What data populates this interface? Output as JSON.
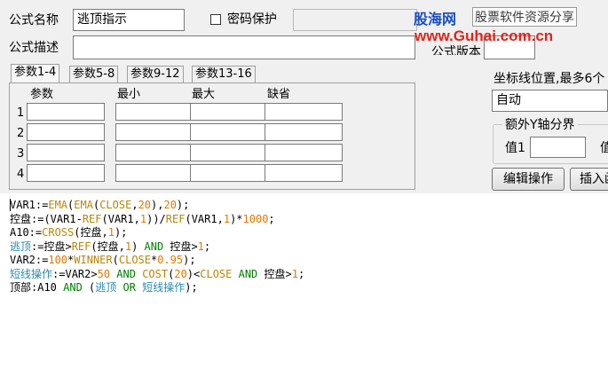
{
  "form": {
    "name_label": "公式名称",
    "name_value": "逃顶指示",
    "password_label": "密码保护",
    "desc_label": "公式描述",
    "version_label_partial": "公式版本"
  },
  "tabs": [
    "参数1-4",
    "参数5-8",
    "参数9-12",
    "参数13-16"
  ],
  "params": {
    "headers": [
      "参数",
      "最小",
      "最大",
      "缺省"
    ],
    "rows": [
      "1",
      "2",
      "3",
      "4"
    ]
  },
  "right_panel": {
    "axis_label": "坐标线位置,最多6个",
    "axis_value": "自动",
    "extra_group": "额外Y轴分界",
    "value1_label": "值1",
    "value2_label": "值",
    "edit_button": "编辑操作",
    "insert_button": "插入函"
  },
  "watermark": {
    "site": "股海网",
    "tagline": "股票软件资源分享",
    "url": "www.Guhai.com.cn"
  },
  "code_lines": [
    [
      {
        "t": "VAR1:=",
        "c": "k"
      },
      {
        "t": "EMA",
        "c": "f"
      },
      {
        "t": "(",
        "c": "k"
      },
      {
        "t": "EMA",
        "c": "f"
      },
      {
        "t": "(",
        "c": "k"
      },
      {
        "t": "CLOSE",
        "c": "f"
      },
      {
        "t": ",",
        "c": "k"
      },
      {
        "t": "20",
        "c": "n"
      },
      {
        "t": "),",
        "c": "k"
      },
      {
        "t": "20",
        "c": "n"
      },
      {
        "t": ");",
        "c": "k"
      }
    ],
    [
      {
        "t": "控盘:=(VAR1-",
        "c": "k"
      },
      {
        "t": "REF",
        "c": "f"
      },
      {
        "t": "(VAR1,",
        "c": "k"
      },
      {
        "t": "1",
        "c": "n"
      },
      {
        "t": "))/",
        "c": "k"
      },
      {
        "t": "REF",
        "c": "f"
      },
      {
        "t": "(VAR1,",
        "c": "k"
      },
      {
        "t": "1",
        "c": "n"
      },
      {
        "t": ")*",
        "c": "k"
      },
      {
        "t": "1000",
        "c": "n"
      },
      {
        "t": ";",
        "c": "k"
      }
    ],
    [
      {
        "t": "A10:=",
        "c": "k"
      },
      {
        "t": "CROSS",
        "c": "f"
      },
      {
        "t": "(控盘,",
        "c": "k"
      },
      {
        "t": "1",
        "c": "n"
      },
      {
        "t": ");",
        "c": "k"
      }
    ],
    [
      {
        "t": "逃顶",
        "c": "c"
      },
      {
        "t": ":=控盘>",
        "c": "k"
      },
      {
        "t": "REF",
        "c": "f"
      },
      {
        "t": "(控盘,",
        "c": "k"
      },
      {
        "t": "1",
        "c": "n"
      },
      {
        "t": ") ",
        "c": "k"
      },
      {
        "t": "AND",
        "c": "g"
      },
      {
        "t": " 控盘>",
        "c": "k"
      },
      {
        "t": "1",
        "c": "n"
      },
      {
        "t": ";",
        "c": "k"
      }
    ],
    [
      {
        "t": "VAR2:=",
        "c": "k"
      },
      {
        "t": "100",
        "c": "n"
      },
      {
        "t": "*",
        "c": "k"
      },
      {
        "t": "WINNER",
        "c": "f"
      },
      {
        "t": "(",
        "c": "k"
      },
      {
        "t": "CLOSE",
        "c": "f"
      },
      {
        "t": "*",
        "c": "k"
      },
      {
        "t": "0.95",
        "c": "n"
      },
      {
        "t": ");",
        "c": "k"
      }
    ],
    [
      {
        "t": "短线操作",
        "c": "c"
      },
      {
        "t": ":=VAR2>",
        "c": "k"
      },
      {
        "t": "50",
        "c": "n"
      },
      {
        "t": " ",
        "c": "k"
      },
      {
        "t": "AND",
        "c": "g"
      },
      {
        "t": " ",
        "c": "k"
      },
      {
        "t": "COST",
        "c": "f"
      },
      {
        "t": "(",
        "c": "k"
      },
      {
        "t": "20",
        "c": "n"
      },
      {
        "t": ")<",
        "c": "k"
      },
      {
        "t": "CLOSE",
        "c": "f"
      },
      {
        "t": " ",
        "c": "k"
      },
      {
        "t": "AND",
        "c": "g"
      },
      {
        "t": " 控盘>",
        "c": "k"
      },
      {
        "t": "1",
        "c": "n"
      },
      {
        "t": ";",
        "c": "k"
      }
    ],
    [
      {
        "t": "顶部:A10 ",
        "c": "k"
      },
      {
        "t": "AND",
        "c": "g"
      },
      {
        "t": " (",
        "c": "k"
      },
      {
        "t": "逃顶",
        "c": "c"
      },
      {
        "t": " ",
        "c": "k"
      },
      {
        "t": "OR",
        "c": "g"
      },
      {
        "t": " ",
        "c": "k"
      },
      {
        "t": "短线操作",
        "c": "c"
      },
      {
        "t": ");",
        "c": "k"
      }
    ]
  ]
}
